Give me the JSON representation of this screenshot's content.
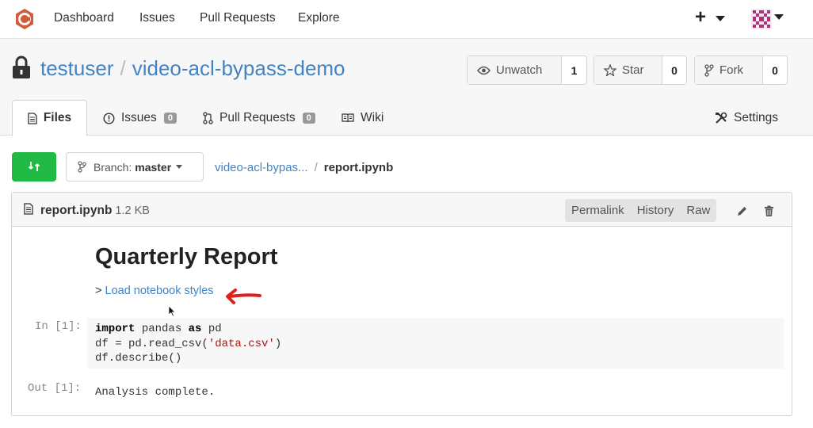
{
  "nav": {
    "items": [
      {
        "label": "Dashboard"
      },
      {
        "label": "Issues"
      },
      {
        "label": "Pull Requests"
      },
      {
        "label": "Explore"
      }
    ],
    "plus_label": "+"
  },
  "repo": {
    "owner": "testuser",
    "separator": "/",
    "name": "video-acl-bypass-demo"
  },
  "actions": {
    "unwatch": {
      "label": "Unwatch",
      "count": "1"
    },
    "star": {
      "label": "Star",
      "count": "0"
    },
    "fork": {
      "label": "Fork",
      "count": "0"
    }
  },
  "tabs": [
    {
      "label": "Files"
    },
    {
      "label": "Issues",
      "badge": "0"
    },
    {
      "label": "Pull Requests",
      "badge": "0"
    },
    {
      "label": "Wiki"
    },
    {
      "label": "Settings"
    }
  ],
  "branch": {
    "prefix": "Branch:",
    "name": "master"
  },
  "breadcrumb": {
    "repo": "video-acl-bypas...",
    "separator": "/",
    "file": "report.ipynb"
  },
  "file": {
    "name": "report.ipynb",
    "size": "1.2 KB",
    "actions": [
      "Permalink",
      "History",
      "Raw"
    ]
  },
  "notebook": {
    "title": "Quarterly Report",
    "load_prefix": ">",
    "load_link": "Load notebook styles",
    "in_prompt": "In [1]:",
    "code": {
      "line1_kw1": "import",
      "line1_mid": " pandas ",
      "line1_kw2": "as",
      "line1_end": " pd",
      "line2_start": "df = pd.read_csv(",
      "line2_str": "'data.csv'",
      "line2_end": ")",
      "line3": "df.describe()"
    },
    "out_prompt": "Out [1]:",
    "output": "Analysis complete."
  },
  "colors": {
    "link": "#4183c4",
    "compare_button": "#21ba45",
    "logo": "#d05c3a",
    "annotation_arrow": "#e0201a"
  }
}
